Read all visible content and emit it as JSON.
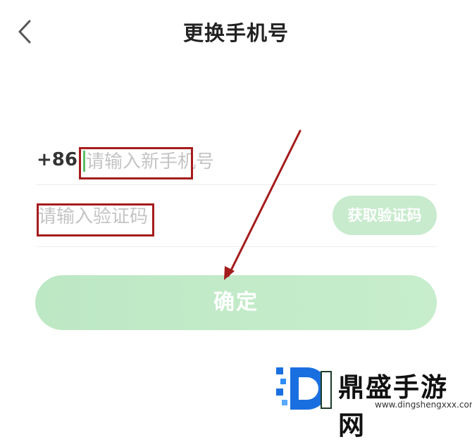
{
  "header": {
    "title": "更换手机号",
    "back_icon": "chevron-left-icon"
  },
  "phone": {
    "country_code": "+86",
    "placeholder": "请输入新手机号"
  },
  "verification": {
    "placeholder": "请输入验证码",
    "get_code_label": "获取验证码"
  },
  "confirm_label": "确定",
  "watermark": {
    "logo_letter": "D",
    "text": "鼎盛手游网",
    "url": "www.dingshengxxx.com"
  },
  "colors": {
    "accent_green": "#c8ebcd",
    "annotation_red": "#a51c1c",
    "cursor_green": "#5fbf68"
  }
}
